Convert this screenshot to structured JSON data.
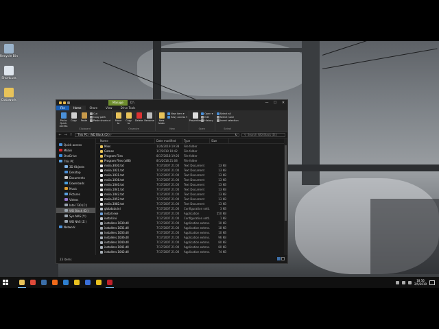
{
  "desktop": {
    "icons": [
      {
        "label": "Recycle Bin",
        "icon": "recycle-bin-icon",
        "color": "#9bb4cc"
      },
      {
        "label": "Shortcuts",
        "icon": "shortcut-doc-icon",
        "color": "#dfe6ee"
      },
      {
        "label": "Datawork",
        "icon": "text-doc-icon",
        "color": "#e8c35a"
      }
    ]
  },
  "window": {
    "context_tab": "Manage",
    "title": "D:\\",
    "controls": {
      "minimize": "—",
      "maximize": "☐",
      "close": "✕"
    },
    "ribbon_tabs": [
      "File",
      "Home",
      "Share",
      "View",
      "Drive Tools"
    ],
    "ribbon": {
      "clipboard": {
        "name": "Clipboard",
        "pin": "Pin to Quick access",
        "copy": "Copy",
        "paste": "Paste",
        "cut": "Cut",
        "copy_path": "Copy path",
        "paste_shortcut": "Paste shortcut"
      },
      "organize": {
        "name": "Organize",
        "move_to": "Move to",
        "copy_to": "Copy to",
        "delete": "Delete",
        "rename": "Rename"
      },
      "new": {
        "name": "New",
        "new_folder": "New folder",
        "new_item": "New item ▾",
        "easy_access": "Easy access ▾"
      },
      "open": {
        "name": "Open",
        "properties": "Properties",
        "open": "Open ▾",
        "edit": "Edit",
        "history": "History"
      },
      "select": {
        "name": "Select",
        "select_all": "Select all",
        "select_none": "Select none",
        "invert": "Invert selection"
      }
    },
    "address": {
      "back": "←",
      "forward": "→",
      "up": "↑",
      "path": "This PC  ›  WD Black (D:)  ›",
      "refresh": "↻"
    },
    "search_placeholder": "Search WD Black (D:)",
    "nav_items": [
      {
        "label": "Quick access",
        "icon": "star-icon",
        "color": "#4a90d9",
        "indent": 0
      },
      {
        "label": "MEGA",
        "icon": "mega-icon",
        "color": "#d9272e",
        "indent": 0
      },
      {
        "label": "OneDrive",
        "icon": "cloud-icon",
        "color": "#3a8de0",
        "indent": 0
      },
      {
        "label": "This PC",
        "icon": "computer-icon",
        "color": "#5aa0e0",
        "indent": 0
      },
      {
        "label": "3D Objects",
        "icon": "cube-icon",
        "color": "#7fb2e5",
        "indent": 1
      },
      {
        "label": "Desktop",
        "icon": "desktop-icon",
        "color": "#4a8fd6",
        "indent": 1
      },
      {
        "label": "Documents",
        "icon": "documents-icon",
        "color": "#c9c9c9",
        "indent": 1
      },
      {
        "label": "Downloads",
        "icon": "download-icon",
        "color": "#4aa0e0",
        "indent": 1
      },
      {
        "label": "Music",
        "icon": "music-icon",
        "color": "#e0a030",
        "indent": 1
      },
      {
        "label": "Pictures",
        "icon": "pictures-icon",
        "color": "#5aa0e0",
        "indent": 1
      },
      {
        "label": "Videos",
        "icon": "video-icon",
        "color": "#9a7ad0",
        "indent": 1
      },
      {
        "label": "Intel 730 (C:)",
        "icon": "drive-icon",
        "color": "#9aa4ae",
        "indent": 1
      },
      {
        "label": "WD Black (D:)",
        "icon": "drive-icon",
        "color": "#9aa4ae",
        "indent": 1,
        "selected": true
      },
      {
        "label": "Syn NAS (Y:)",
        "icon": "network-drive-icon",
        "color": "#9aa4ae",
        "indent": 1
      },
      {
        "label": "WD NAS (Z:)",
        "icon": "network-drive-icon",
        "color": "#9aa4ae",
        "indent": 1
      },
      {
        "label": "Network",
        "icon": "network-icon",
        "color": "#4a90d9",
        "indent": 0
      }
    ],
    "columns": [
      "Name",
      "Date modified",
      "Type",
      "Size"
    ],
    "files": [
      {
        "name": "Mios",
        "date": "1/26/2019 19:38",
        "type": "File folder",
        "size": "",
        "icon": "folder-icon",
        "color": "#e8c35a"
      },
      {
        "name": "Games",
        "date": "1/7/2019 10:42",
        "type": "File folder",
        "size": "",
        "icon": "folder-icon",
        "color": "#e8c35a"
      },
      {
        "name": "Program Files",
        "date": "8/17/2018 19:26",
        "type": "File folder",
        "size": "",
        "icon": "folder-icon",
        "color": "#e8c35a"
      },
      {
        "name": "Program Files (x86)",
        "date": "8/1/2018 21:08",
        "type": "File folder",
        "size": "",
        "icon": "folder-icon",
        "color": "#e8c35a"
      },
      {
        "name": "msiia.3030.txt",
        "date": "7/17/2007 21:00",
        "type": "Text Document",
        "size": "13 KB",
        "icon": "text-file-icon",
        "color": "#e6e6e6"
      },
      {
        "name": "msiia.1021.txt",
        "date": "7/17/2007 21:00",
        "type": "Text Document",
        "size": "13 KB",
        "icon": "text-file-icon",
        "color": "#e6e6e6"
      },
      {
        "name": "msiia.1031.txt",
        "date": "7/17/2007 21:00",
        "type": "Text Document",
        "size": "13 KB",
        "icon": "text-file-icon",
        "color": "#e6e6e6"
      },
      {
        "name": "msiia.1036.txt",
        "date": "7/17/2007 21:00",
        "type": "Text Document",
        "size": "13 KB",
        "icon": "text-file-icon",
        "color": "#e6e6e6"
      },
      {
        "name": "msiia.1040.txt",
        "date": "7/17/2007 21:00",
        "type": "Text Document",
        "size": "13 KB",
        "icon": "text-file-icon",
        "color": "#e6e6e6"
      },
      {
        "name": "msiia.1041.txt",
        "date": "7/17/2007 21:00",
        "type": "Text Document",
        "size": "13 KB",
        "icon": "text-file-icon",
        "color": "#e6e6e6"
      },
      {
        "name": "msiia.1042.txt",
        "date": "7/17/2007 21:00",
        "type": "Text Document",
        "size": "13 KB",
        "icon": "text-file-icon",
        "color": "#e6e6e6"
      },
      {
        "name": "msiia.2052.txt",
        "date": "7/17/2007 21:00",
        "type": "Text Document",
        "size": "13 KB",
        "icon": "text-file-icon",
        "color": "#e6e6e6"
      },
      {
        "name": "msiia.3082.txt",
        "date": "7/17/2007 21:00",
        "type": "Text Document",
        "size": "13 KB",
        "icon": "text-file-icon",
        "color": "#e6e6e6"
      },
      {
        "name": "globdata.ini",
        "date": "7/17/2007 21:00",
        "type": "Configuration setti...",
        "size": "3 KB",
        "icon": "ini-file-icon",
        "color": "#bfc7d0"
      },
      {
        "name": "install.exe",
        "date": "7/17/2007 21:00",
        "type": "Application",
        "size": "550 KB",
        "icon": "exe-file-icon",
        "color": "#6ea0d8"
      },
      {
        "name": "install.ini",
        "date": "7/17/2007 21:00",
        "type": "Configuration setti...",
        "size": "1 KB",
        "icon": "ini-file-icon",
        "color": "#bfc7d0"
      },
      {
        "name": "installers.1030.dll",
        "date": "7/17/2007 21:00",
        "type": "Application extens...",
        "size": "10 KB",
        "icon": "dll-file-icon",
        "color": "#a8b0b8"
      },
      {
        "name": "installers.1031.dll",
        "date": "7/17/2007 21:00",
        "type": "Application extens...",
        "size": "18 KB",
        "icon": "dll-file-icon",
        "color": "#a8b0b8"
      },
      {
        "name": "installers.1033.dll",
        "date": "7/17/2007 21:00",
        "type": "Application extens...",
        "size": "10 KB",
        "icon": "dll-file-icon",
        "color": "#a8b0b8"
      },
      {
        "name": "installers.1036.dll",
        "date": "7/17/2007 21:00",
        "type": "Application extens...",
        "size": "96 KB",
        "icon": "dll-file-icon",
        "color": "#a8b0b8"
      },
      {
        "name": "installers.1040.dll",
        "date": "7/17/2007 21:00",
        "type": "Application extens...",
        "size": "80 KB",
        "icon": "dll-file-icon",
        "color": "#a8b0b8"
      },
      {
        "name": "installers.1041.dll",
        "date": "7/17/2007 21:00",
        "type": "Application extens...",
        "size": "80 KB",
        "icon": "dll-file-icon",
        "color": "#a8b0b8"
      },
      {
        "name": "installers.1042.dll",
        "date": "7/17/2007 21:00",
        "type": "Application extens...",
        "size": "74 KB",
        "icon": "dll-file-icon",
        "color": "#a8b0b8"
      }
    ],
    "status": "23 items"
  },
  "taskbar": {
    "apps": [
      {
        "icon": "file-explorer-icon",
        "color": "#e8c35a",
        "active": true
      },
      {
        "icon": "chrome-icon",
        "color": "#e04a3a",
        "active": false
      },
      {
        "icon": "steam-icon",
        "color": "#3b6ea8",
        "active": false
      },
      {
        "icon": "origin-icon",
        "color": "#f06a1a",
        "active": false
      },
      {
        "icon": "vegas-icon",
        "color": "#2e7fcf",
        "active": false
      },
      {
        "icon": "smiley-icon",
        "color": "#e8c020",
        "active": false
      },
      {
        "icon": "malwarebytes-icon",
        "color": "#3a6fd8",
        "active": false
      },
      {
        "icon": "notes-icon",
        "color": "#e8c020",
        "active": false
      },
      {
        "icon": "record-icon",
        "color": "#c0202a",
        "active": true
      }
    ],
    "time": "18:56",
    "date": "2/5/2019"
  }
}
